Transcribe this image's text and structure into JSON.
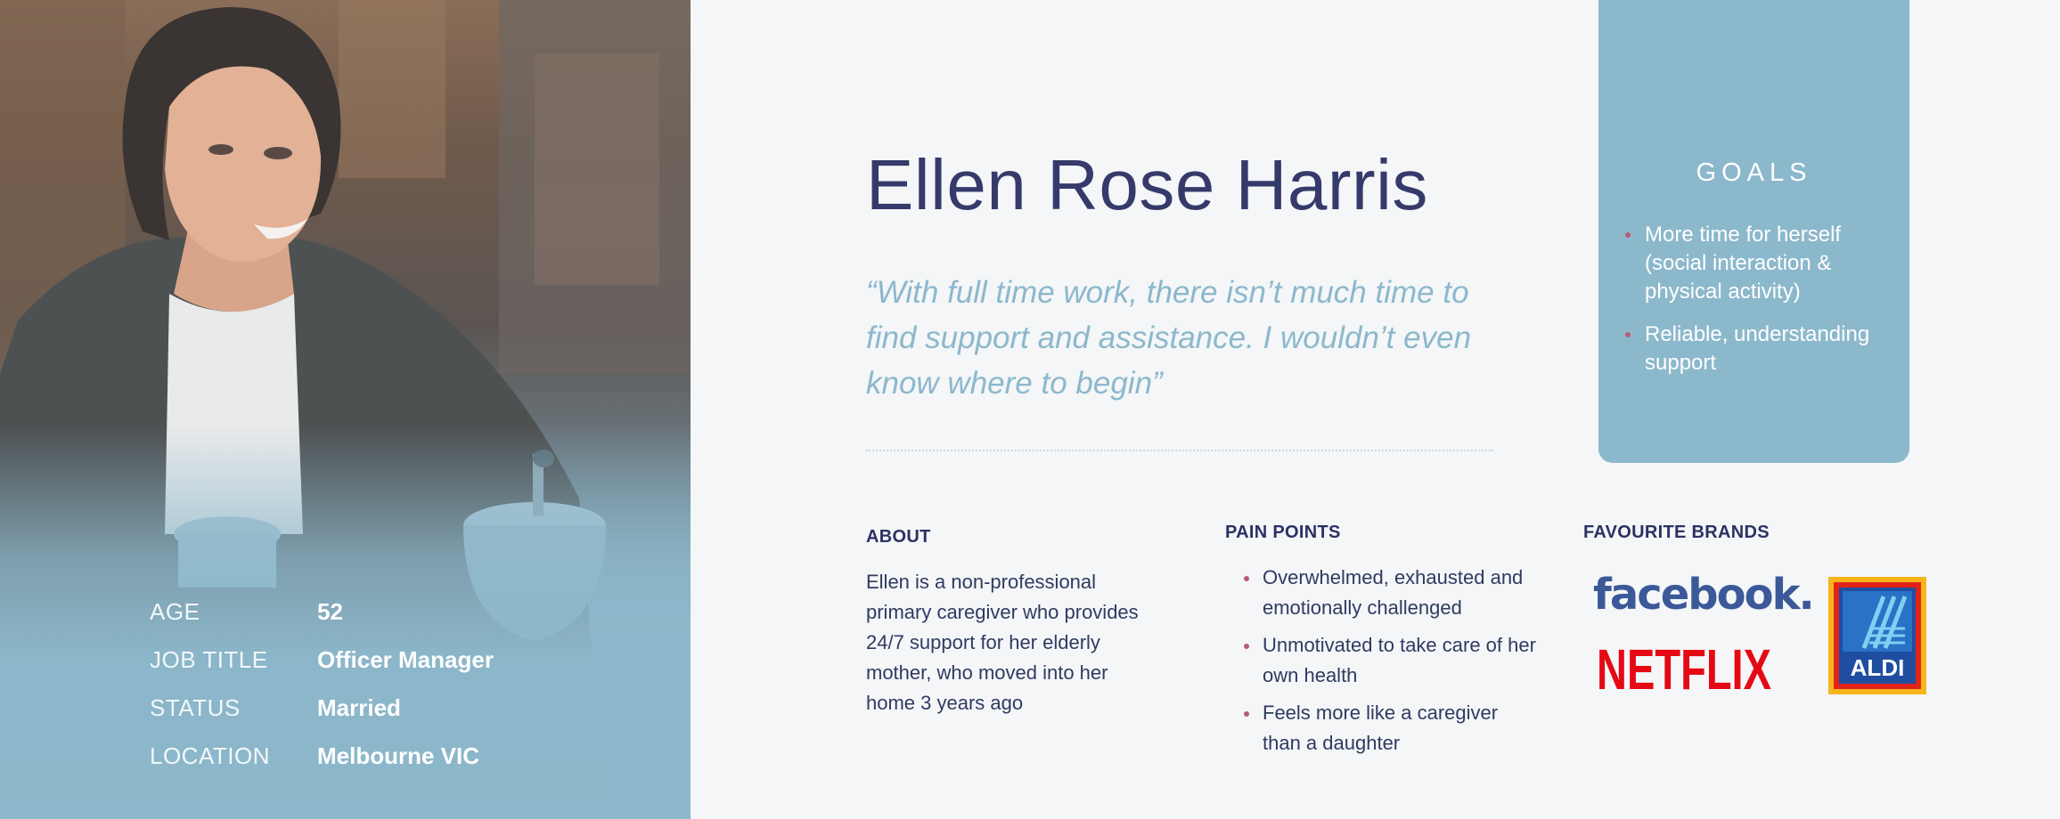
{
  "persona": {
    "name": "Ellen Rose Harris",
    "quote": "“With full time work, there isn’t much time to find support and assistance. I wouldn’t even know where to begin”"
  },
  "facts": [
    {
      "label": "AGE",
      "value": "52"
    },
    {
      "label": "JOB TITLE",
      "value": "Officer Manager"
    },
    {
      "label": "STATUS",
      "value": "Married"
    },
    {
      "label": "LOCATION",
      "value": "Melbourne VIC"
    }
  ],
  "goals": {
    "title": "GOALS",
    "items": [
      "More time for herself (social interaction & physical activity)",
      "Reliable, understanding support"
    ]
  },
  "about": {
    "title": "ABOUT",
    "text": "Ellen is a non-professional primary caregiver who provides 24/7 support for her elderly mother, who moved into her home 3 years ago"
  },
  "pain_points": {
    "title": "PAIN POINTS",
    "items": [
      "Overwhelmed, exhausted and emotionally challenged",
      "Unmotivated to take care of her own health",
      "Feels more like a caregiver than a daughter"
    ]
  },
  "brands": {
    "title": "FAVOURITE BRANDS",
    "facebook": "facebook.",
    "netflix": "NETFLIX",
    "aldi": "ALDI"
  },
  "colors": {
    "accent_blue": "#8cb8cc",
    "navy": "#363a6a",
    "bullet": "#b85a74",
    "background": "#f4f6f8"
  }
}
